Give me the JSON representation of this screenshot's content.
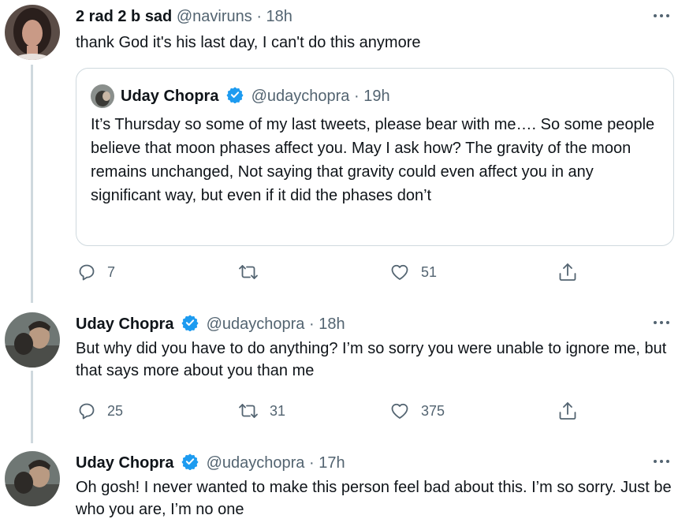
{
  "tweets": [
    {
      "name": "2 rad 2 b sad",
      "handle": "@naviruns",
      "separator": "·",
      "time": "18h",
      "text": "thank God it's his last day, I can't do this anymore",
      "quote": {
        "name": "Uday Chopra",
        "handle": "@udaychopra",
        "separator": "·",
        "time": "19h",
        "text": "It’s Thursday so some of my last tweets, please bear with me…. So some people believe that moon phases affect you. May I ask how? The gravity of the moon remains unchanged,  Not saying that gravity could even affect you in any significant way, but even if it did the phases don’t"
      },
      "replies": "7",
      "retweets": "",
      "likes": "51"
    },
    {
      "name": "Uday Chopra",
      "handle": "@udaychopra",
      "separator": "·",
      "time": "18h",
      "text": "But why did you have to do anything? I’m so sorry you were unable to ignore me, but that says more about you than me",
      "replies": "25",
      "retweets": "31",
      "likes": "375"
    },
    {
      "name": "Uday Chopra",
      "handle": "@udaychopra",
      "separator": "·",
      "time": "17h",
      "text": "Oh gosh! I never wanted to make this person feel bad about this. I’m so sorry. Just be who you are, I’m no one"
    }
  ],
  "icons": {
    "reply": "reply-icon",
    "retweet": "retweet-icon",
    "like": "heart-icon",
    "share": "share-icon",
    "more": "more-icon",
    "verified": "verified-badge-icon"
  },
  "colors": {
    "verified": "#1d9bf0",
    "secondary_text": "#536471",
    "thread_line": "#cfd9de",
    "border": "#cfd9de"
  }
}
